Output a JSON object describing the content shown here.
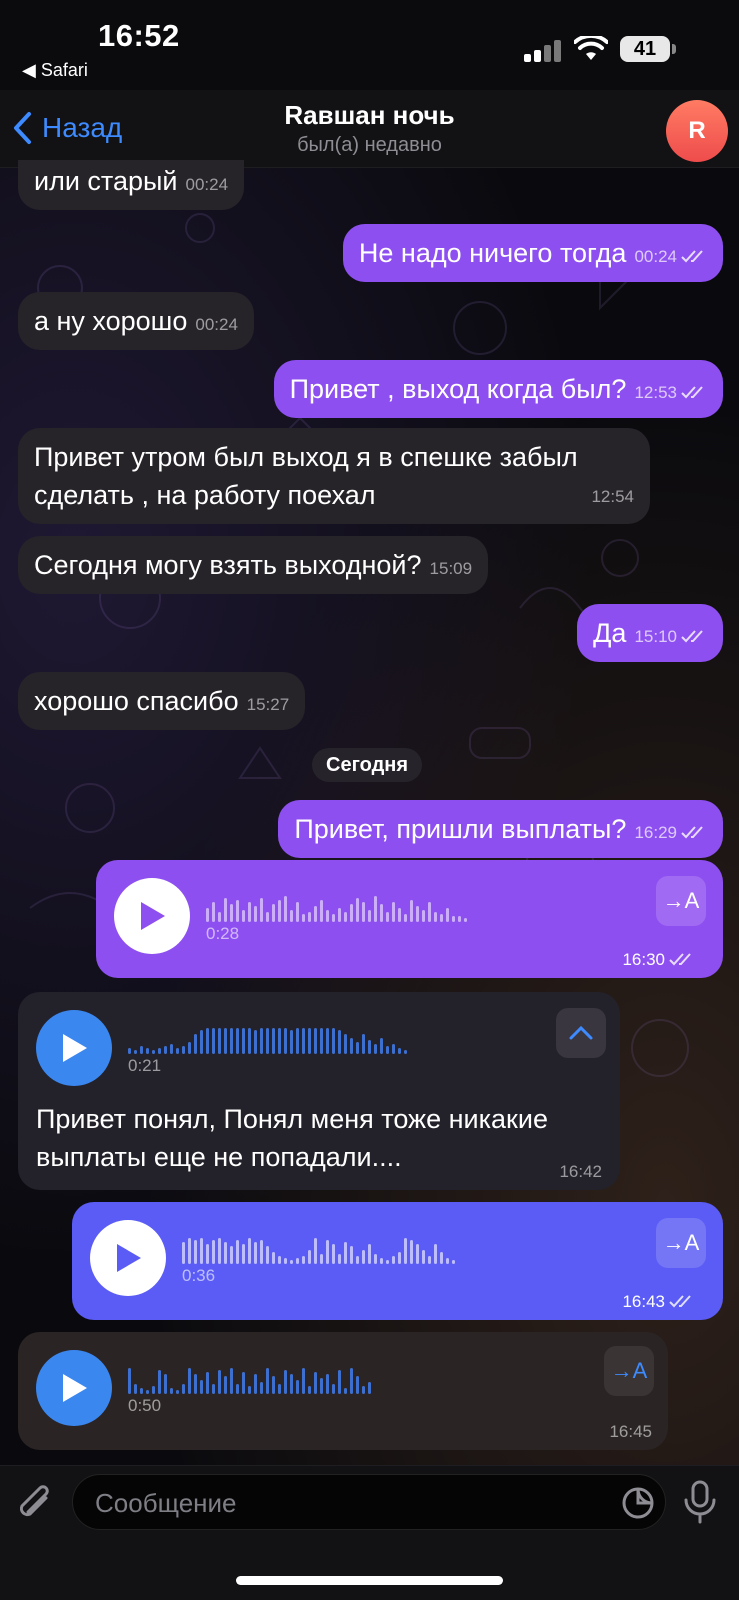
{
  "status_bar": {
    "time": "16:52",
    "back_app": "◀ Safari",
    "battery": "41"
  },
  "header": {
    "back_label": "Назад",
    "title": "Rавшан ночь",
    "subtitle": "был(а) недавно",
    "avatar_letter": "R"
  },
  "messages": [
    {
      "dir": "in",
      "text": "или старый",
      "time": "00:24"
    },
    {
      "dir": "out",
      "text": "Не надо ничего тогда",
      "time": "00:24"
    },
    {
      "dir": "in",
      "text": "а ну хорошо",
      "time": "00:24"
    },
    {
      "dir": "out",
      "text": "Привет , выход когда был?",
      "time": "12:53"
    },
    {
      "dir": "in",
      "text": "Привет утром был выход я в спешке забыл сделать , на работу поехал",
      "time": "12:54"
    },
    {
      "dir": "in",
      "text": "Сегодня могу взять выходной?",
      "time": "15:09"
    },
    {
      "dir": "out",
      "text": "Да",
      "time": "15:10"
    },
    {
      "dir": "in",
      "text": "хорошо спасибо",
      "time": "15:27"
    },
    {
      "dir": "out",
      "text": "Привет, пришли выплаты?",
      "time": "16:29"
    }
  ],
  "date_separator": "Сегодня",
  "voice_messages": [
    {
      "dir": "out",
      "duration": "0:28",
      "time": "16:30",
      "transcribe_label": "→A"
    },
    {
      "dir": "in",
      "duration": "0:21",
      "time": "16:42",
      "transcript": "Привет понял, Понял меня тоже никакие выплаты еще не попадали...."
    },
    {
      "dir": "out",
      "duration": "0:36",
      "time": "16:43",
      "transcribe_label": "→A"
    },
    {
      "dir": "in",
      "duration": "0:50",
      "time": "16:45",
      "transcribe_label": "→A"
    }
  ],
  "input": {
    "placeholder": "Сообщение"
  },
  "colors": {
    "outgoing": "#8e4ff0",
    "outgoing_blue": "#5a5cf5",
    "incoming": "#262329",
    "accent": "#3d8bff"
  },
  "icons": [
    "paperclip-icon",
    "sticker-icon",
    "microphone-icon",
    "play-icon",
    "chevron-left-icon",
    "chevron-up-icon",
    "double-check-icon"
  ]
}
